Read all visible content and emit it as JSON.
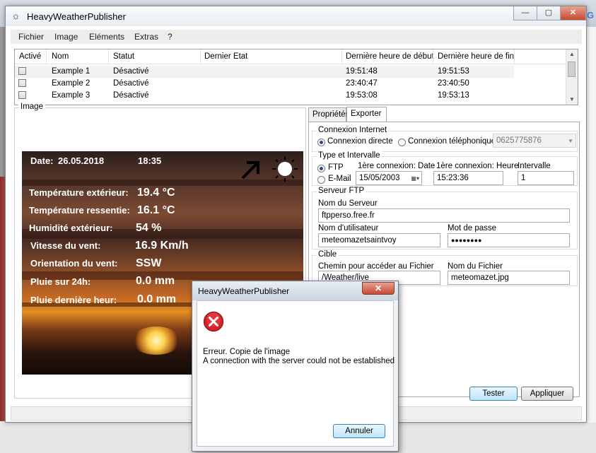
{
  "window": {
    "title": "HeavyWeatherPublisher"
  },
  "menu": {
    "items": [
      "Fichier",
      "Image",
      "Eléments",
      "Extras",
      "?"
    ]
  },
  "table": {
    "columns": [
      "Activé",
      "Nom",
      "Statut",
      "Dernier Etat",
      "Dernière heure de début",
      "Dernière heure de fin"
    ],
    "rows": [
      {
        "active": false,
        "name": "Example 1",
        "status": "Désactivé",
        "last_state": "",
        "start": "19:51:48",
        "end": "19:51:53"
      },
      {
        "active": false,
        "name": "Example 2",
        "status": "Désactivé",
        "last_state": "",
        "start": "23:40:47",
        "end": "23:40:50"
      },
      {
        "active": false,
        "name": "Example 3",
        "status": "Désactivé",
        "last_state": "",
        "start": "19:53:08",
        "end": "19:53:13"
      }
    ]
  },
  "image_panel": {
    "title": "Image",
    "weather": {
      "date_label": "Date:",
      "date": "26.05.2018",
      "time": "18:35",
      "rows": [
        {
          "label": "Température extérieur:",
          "value": "19.4 °C"
        },
        {
          "label": "Température ressentie:",
          "value": "16.1 °C"
        },
        {
          "label": "Humidité extérieur:",
          "value": "54 %"
        },
        {
          "label": "Vitesse du vent:",
          "value": "16.9 Km/h"
        },
        {
          "label": "Orientation du vent:",
          "value": "SSW"
        },
        {
          "label": "Pluie sur 24h:",
          "value": "0.0 mm"
        },
        {
          "label": "Pluie dernière heur:",
          "value": "0.0 mm"
        }
      ]
    }
  },
  "tabs": {
    "items": [
      "Propriétés",
      "Exporter"
    ],
    "active": "Exporter"
  },
  "export": {
    "internet": {
      "title": "Connexion Internet",
      "direct": "Connexion directe",
      "phone": "Connexion téléphonique",
      "phone_number": "0625775876"
    },
    "type": {
      "title": "Type et Intervalle",
      "ftp": "FTP",
      "email": "E-Mail",
      "date_label": "1ère connexion: Date",
      "date_value": "15/05/2003",
      "hour_label": "1ère connexion: Heure",
      "hour_value": "15:23:36",
      "interval_label": "Intervalle",
      "interval_value": "1"
    },
    "ftp": {
      "title": "Serveur FTP",
      "server_label": "Nom du Serveur",
      "server_value": "ftpperso.free.fr",
      "user_label": "Nom d'utilisateur",
      "user_value": "meteomazetsaintvoy",
      "pass_label": "Mot de passe",
      "pass_value": "●●●●●●●●"
    },
    "target": {
      "title": "Cible",
      "path_label": "Chemin pour accéder au Fichier",
      "path_value": "/Weather/live",
      "file_label": "Nom du Fichier",
      "file_value": "meteomazet.jpg"
    },
    "test_button": "Tester",
    "apply_button": "Appliquer"
  },
  "dialog": {
    "title": "HeavyWeatherPublisher",
    "line1": "Erreur. Copie de l'image",
    "line2": "A connection with the server could not be established",
    "cancel_button": "Annuler"
  },
  "colors": {
    "title_bg": "#e9eef4",
    "close_red": "#c64a33",
    "focus_blue": "#3c7fb1",
    "error_red": "#d8202a"
  }
}
